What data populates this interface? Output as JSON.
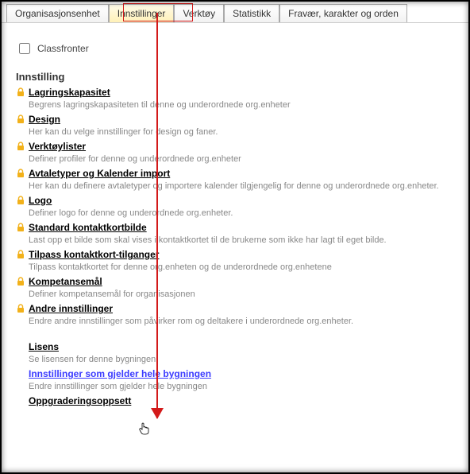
{
  "tabs": [
    {
      "label": "Organisasjonsenhet",
      "active": false
    },
    {
      "label": "Innstillinger",
      "active": true
    },
    {
      "label": "Verktøy",
      "active": false
    },
    {
      "label": "Statistikk",
      "active": false
    },
    {
      "label": "Fravær, karakter og orden",
      "active": false
    }
  ],
  "checkbox_label": "Classfronter",
  "section_title": "Innstilling",
  "settings": [
    {
      "title": "Lagringskapasitet",
      "desc": "Begrens lagringskapasiteten til denne og underordnede org.enheter"
    },
    {
      "title": "Design",
      "desc": "Her kan du velge innstillinger for design og faner."
    },
    {
      "title": "Verktøylister",
      "desc": "Definer profiler for denne og underordnede org.enheter"
    },
    {
      "title": "Avtaletyper og Kalender import",
      "desc": "Her kan du definere avtaletyper og importere kalender tilgjengelig for denne og underordnede org.enheter."
    },
    {
      "title": "Logo",
      "desc": "Definer logo for denne og underordnede org.enheter."
    },
    {
      "title": "Standard kontaktkortbilde",
      "desc": "Last opp et bilde som skal vises i kontaktkortet til de brukerne som ikke har lagt til eget bilde."
    },
    {
      "title": "Tilpass kontaktkort-tilganger",
      "desc": "Tilpass kontaktkortet for denne org.enheten og de underordnede org.enhetene"
    },
    {
      "title": "Kompetansemål",
      "desc": "Definer kompetansemål for organisasjonen"
    },
    {
      "title": "Andre innstillinger",
      "desc": "Endre andre innstillinger som påvirker rom og deltakere i underordnede org.enheter."
    }
  ],
  "extra": [
    {
      "title": "Lisens",
      "desc": "Se lisensen for denne bygningen",
      "link_style": "norm"
    },
    {
      "title": "Innstillinger som gjelder hele bygningen",
      "desc": "Endre innstillinger som gjelder hele bygningen",
      "link_style": "blue"
    },
    {
      "title": "Oppgraderingsoppsett",
      "desc": "",
      "link_style": "norm"
    }
  ]
}
